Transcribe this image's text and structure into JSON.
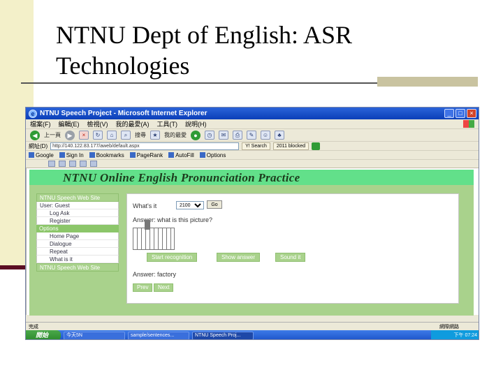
{
  "slide": {
    "title_line1": "NTNU Dept of English: ASR",
    "title_line2": "Technologies"
  },
  "window": {
    "title": "NTNU Speech Project - Microsoft Internet Explorer",
    "buttons": {
      "min": "_",
      "max": "□",
      "close": "×"
    }
  },
  "ie": {
    "menu": [
      "檔案(F)",
      "編輯(E)",
      "檢視(V)",
      "我的最愛(A)",
      "工具(T)",
      "說明(H)"
    ],
    "toolbar": {
      "back": "上一頁",
      "search": "搜尋",
      "favorites": "我的最愛"
    },
    "address": {
      "label": "網址(D)",
      "url": "http://140.122.83.177/aweb/default.aspx",
      "tag1": "Y! Search",
      "tag2": "2011 blocked"
    },
    "links": [
      "Google",
      "Sign In",
      "Bookmarks",
      "PageRank",
      "AutoFill",
      "Options"
    ],
    "status_left": "完成",
    "status_right": "網際網路"
  },
  "page": {
    "title": "NTNU Online English Pronunciation Practice",
    "sidebar": {
      "header": "NTNU Speech Web Site",
      "items": [
        "User: Guest",
        "Log Ask",
        "Register"
      ],
      "options_label": "Options",
      "option_items": [
        "Home Page",
        "Dialogue",
        "Repeat",
        "What is it"
      ],
      "footer": "NTNU Speech Web Site"
    },
    "exercise": {
      "whats_label": "What's it",
      "select_value": "2100",
      "go_label": "Go",
      "question": "Answer: what is this picture?",
      "btn_start": "Start recognition",
      "btn_show": "Show answer",
      "btn_sound": "Sound it",
      "answer": "Answer: factory",
      "btn_prev": "Prev",
      "btn_next": "Next"
    }
  },
  "taskbar": {
    "start": "開始",
    "tasks": [
      "今天5N",
      "sample/sentences...",
      "NTNU Speech Proj..."
    ],
    "clock": "下午 07:24"
  }
}
